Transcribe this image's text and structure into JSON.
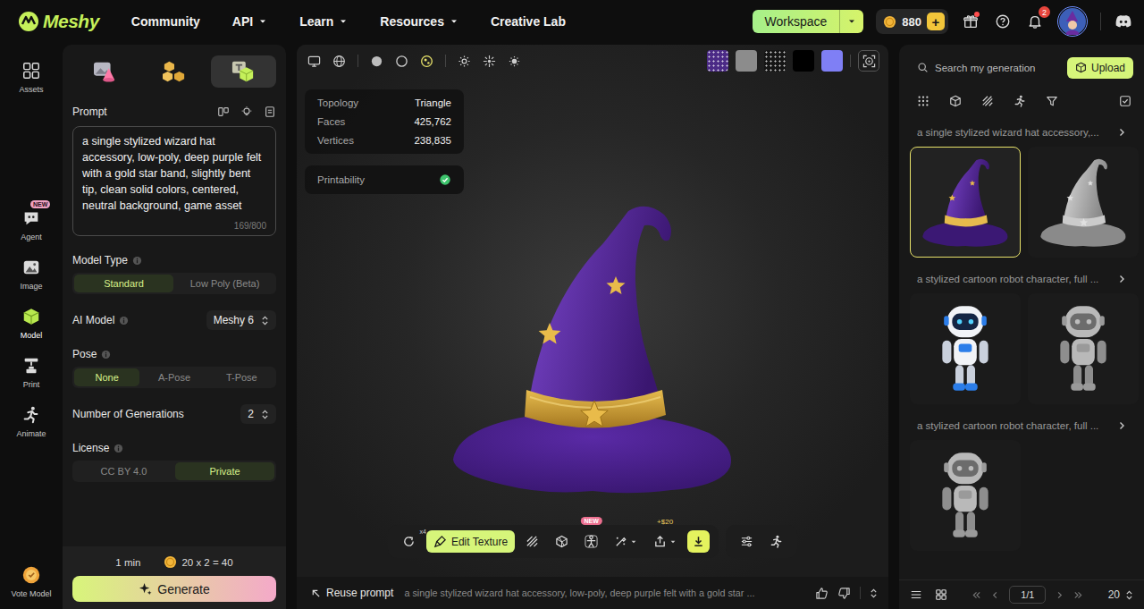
{
  "brand": {
    "name": "Meshy"
  },
  "nav": [
    {
      "label": "Community",
      "dropdown": false
    },
    {
      "label": "API",
      "dropdown": true
    },
    {
      "label": "Learn",
      "dropdown": true
    },
    {
      "label": "Resources",
      "dropdown": true
    },
    {
      "label": "Creative Lab",
      "dropdown": false
    }
  ],
  "header": {
    "workspace": "Workspace",
    "credits": "880",
    "plus": "+",
    "notifications": "2",
    "gift_dot": true
  },
  "rail": {
    "top": [
      {
        "kind": "assets",
        "label": "Assets",
        "selected": false,
        "badge": ""
      }
    ],
    "tools": [
      {
        "kind": "agent",
        "label": "Agent",
        "selected": false,
        "badge": "NEW"
      },
      {
        "kind": "image",
        "label": "Image",
        "selected": false,
        "badge": ""
      },
      {
        "kind": "model",
        "label": "Model",
        "selected": true,
        "badge": ""
      },
      {
        "kind": "print",
        "label": "Print",
        "selected": false,
        "badge": ""
      },
      {
        "kind": "animate",
        "label": "Animate",
        "selected": false,
        "badge": ""
      }
    ],
    "bottom": [
      {
        "kind": "vote",
        "label": "Vote Model",
        "selected": false,
        "badge": ""
      }
    ]
  },
  "mode_tabs": [
    {
      "kind": "image",
      "selected": false
    },
    {
      "kind": "multi",
      "selected": false
    },
    {
      "kind": "text",
      "selected": true
    }
  ],
  "prompt": {
    "label": "Prompt",
    "text": "a single stylized wizard hat accessory, low-poly, deep purple felt with a gold star band, slightly bent tip, clean solid colors, centered, neutral background, game asset",
    "count": "169/800"
  },
  "settings": [
    {
      "kind": "segmented",
      "label": "Model Type",
      "info": true,
      "value": "",
      "options": [
        {
          "label": "Standard",
          "selected": true
        },
        {
          "label": "Low Poly (Beta)",
          "selected": false
        }
      ]
    },
    {
      "kind": "select",
      "label": "AI Model",
      "info": true,
      "value": "Meshy 6",
      "options": []
    },
    {
      "kind": "segmented",
      "label": "Pose",
      "info": true,
      "value": "",
      "options": [
        {
          "label": "None",
          "selected": true
        },
        {
          "label": "A-Pose",
          "selected": false
        },
        {
          "label": "T-Pose",
          "selected": false
        }
      ]
    },
    {
      "kind": "stepper",
      "label": "Number of Generations",
      "info": false,
      "value": "2",
      "options": []
    },
    {
      "kind": "segmented",
      "label": "License",
      "info": true,
      "value": "",
      "options": [
        {
          "label": "CC BY 4.0",
          "selected": false
        },
        {
          "label": "Private",
          "selected": true
        }
      ]
    }
  ],
  "footer": {
    "time": "1 min",
    "cost": "20 x 2 = 40",
    "button": "Generate"
  },
  "render_modes": [
    {
      "kind": "solid",
      "selected": false
    },
    {
      "kind": "wire",
      "selected": false
    },
    {
      "kind": "textured",
      "selected": true
    }
  ],
  "backgrounds": [
    {
      "color": "#4b2a86",
      "pattern": true
    },
    {
      "color": "#8c8c8c",
      "pattern": false
    },
    {
      "color": "#151515",
      "pattern": true
    },
    {
      "color": "#000000",
      "pattern": false
    },
    {
      "color": "#7f7ff5",
      "pattern": false
    }
  ],
  "stats": [
    {
      "label": "Topology",
      "value": "Triangle"
    },
    {
      "label": "Faces",
      "value": "425,762"
    },
    {
      "label": "Vertices",
      "value": "238,835"
    }
  ],
  "printability": {
    "label": "Printability",
    "ok": true
  },
  "toolbar": [
    {
      "kind": "rotate",
      "label": "",
      "badge": "x4",
      "dropdown": false
    },
    {
      "kind": "texture",
      "label": "Edit Texture",
      "badge": "",
      "dropdown": false
    },
    {
      "kind": "hatch",
      "label": "",
      "badge": "",
      "dropdown": false
    },
    {
      "kind": "remesh",
      "label": "",
      "badge": "",
      "dropdown": false
    },
    {
      "kind": "rig",
      "label": "",
      "badge": "NEW",
      "dropdown": false
    },
    {
      "kind": "brush",
      "label": "",
      "badge": "",
      "dropdown": true
    },
    {
      "kind": "export",
      "label": "",
      "badge": "+$20",
      "dropdown": true
    },
    {
      "kind": "download",
      "label": "",
      "badge": "",
      "dropdown": false
    }
  ],
  "toolbar_extra": [
    {
      "kind": "adjust"
    },
    {
      "kind": "animate"
    }
  ],
  "prompt_bar": {
    "reuse": "Reuse prompt",
    "text": "a single stylized wizard hat accessory, low-poly, deep purple felt with a gold star ..."
  },
  "search": {
    "placeholder": "Search my generation"
  },
  "upload": "Upload",
  "groups": [
    {
      "title": "a single stylized wizard hat accessory,...",
      "items": [
        {
          "kind": "hat",
          "textured": true,
          "selected": true
        },
        {
          "kind": "hat",
          "textured": false,
          "selected": false
        }
      ]
    },
    {
      "title": "a stylized cartoon robot character, full ...",
      "items": [
        {
          "kind": "robot",
          "textured": true,
          "selected": false
        },
        {
          "kind": "robot",
          "textured": false,
          "selected": false
        }
      ]
    },
    {
      "title": "a stylized cartoon robot character, full ...",
      "items": [
        {
          "kind": "robot",
          "textured": false,
          "selected": false
        }
      ]
    }
  ],
  "pagination": {
    "page": "1/1",
    "per_page": "20"
  }
}
